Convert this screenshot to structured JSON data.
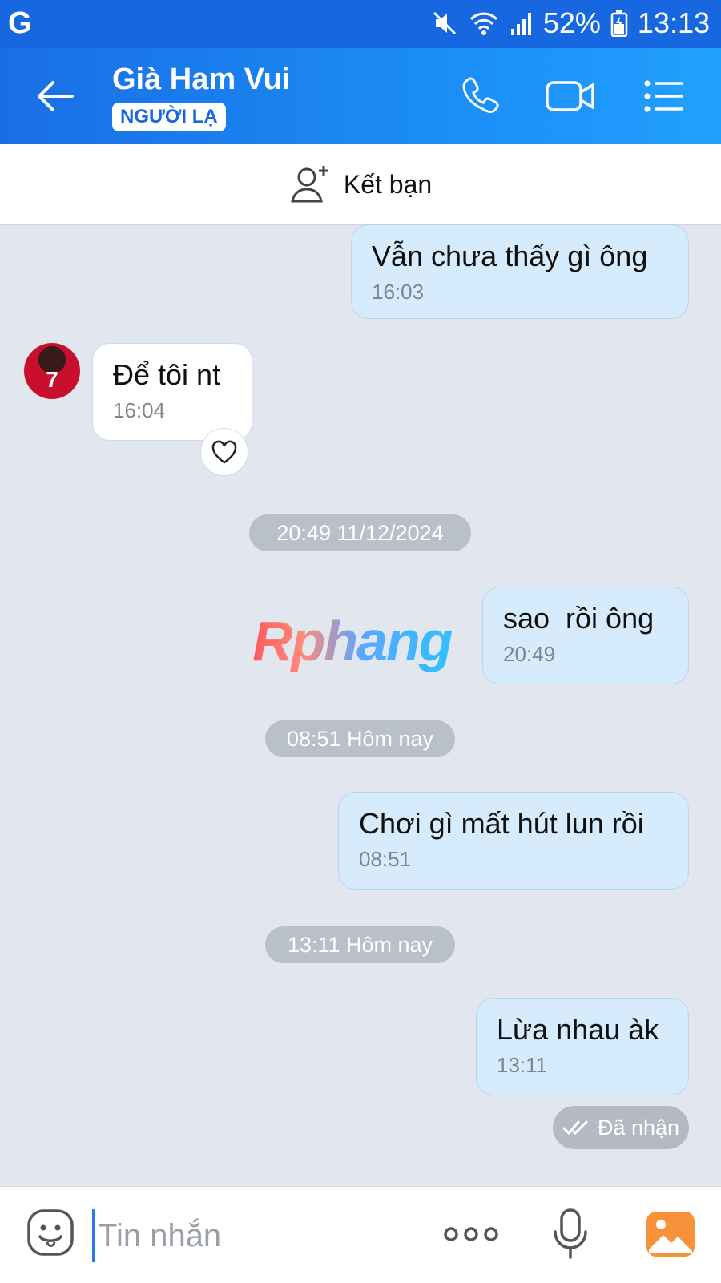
{
  "status_bar": {
    "app_icon_letter": "G",
    "battery": "52%",
    "time": "13:13"
  },
  "header": {
    "contact_name": "Già Ham Vui",
    "badge": "NGƯỜI LẠ",
    "icons": [
      "back-arrow-icon",
      "phone-icon",
      "video-call-icon",
      "menu-list-icon"
    ]
  },
  "add_friend": {
    "label": "Kết bạn",
    "icon": "add-user-icon"
  },
  "messages": [
    {
      "from": "me",
      "text": "Vẫn chưa thấy gì ông",
      "time": "16:03"
    },
    {
      "from": "other",
      "text": "Để tôi nt",
      "time": "16:04",
      "avatar_text": "7"
    },
    {
      "type": "separator",
      "text": "20:49 11/12/2024"
    },
    {
      "from": "me",
      "text": "sao  rồi ông",
      "time": "20:49"
    },
    {
      "type": "separator",
      "text": "08:51 Hôm nay"
    },
    {
      "from": "me",
      "text": "Chơi gì mất hút lun rồi",
      "time": "08:51"
    },
    {
      "type": "separator",
      "text": "13:11 Hôm nay"
    },
    {
      "from": "me",
      "text": "Lừa nhau àk",
      "time": "13:11"
    }
  ],
  "watermark": "Rphang",
  "delivery_status": "Đã nhận",
  "composer": {
    "placeholder": "Tin nhắn",
    "icons": [
      "emoji-icon",
      "more-dots-icon",
      "microphone-icon",
      "image-icon"
    ]
  },
  "colors": {
    "header": "#1b7ff0",
    "bubble_me": "#d6ecfd",
    "bubble_other": "#ffffff",
    "background": "#e2e7ef",
    "time_pill": "#b9c0c9"
  }
}
